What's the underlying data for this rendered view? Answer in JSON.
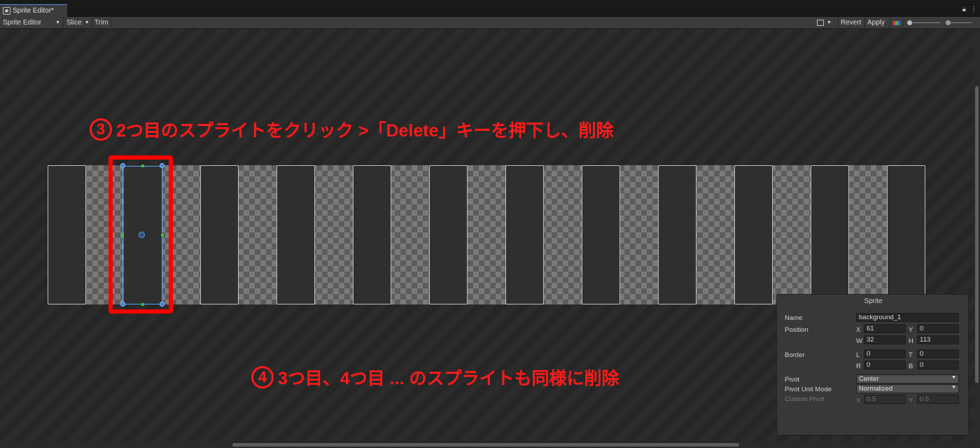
{
  "tab": {
    "title": "Sprite Editor*",
    "lock_icon": "lock-icon",
    "menu_icon": "kebab-menu-icon"
  },
  "toolbar": {
    "mode": "Sprite Editor",
    "slice": "Slice",
    "trim": "Trim",
    "revert": "Revert",
    "apply": "Apply"
  },
  "annotations": {
    "step3_num": "3",
    "step3_text": "2つ目のスプライトをクリック >「Delete」キーを押下し、削除",
    "step4_num": "4",
    "step4_text": "3つ目、4つ目 ... のスプライトも同様に削除",
    "color": "#ff1a1a"
  },
  "sprite_panel": {
    "title": "Sprite",
    "name_label": "Name",
    "name_value": "background_1",
    "position_label": "Position",
    "x_label": "X",
    "x_value": "61",
    "y_label": "Y",
    "y_value": "0",
    "w_label": "W",
    "w_value": "32",
    "h_label": "H",
    "h_value": "113",
    "border_label": "Border",
    "l_label": "L",
    "l_value": "0",
    "t_label": "T",
    "t_value": "0",
    "r_label": "R",
    "r_value": "0",
    "b_label": "B",
    "b_value": "0",
    "pivot_label": "Pivot",
    "pivot_value": "Center",
    "pivot_unit_label": "Pivot Unit Mode",
    "pivot_unit_value": "Normalized",
    "custom_pivot_label": "Custom Pivot",
    "cp_x_label": "X",
    "cp_x_value": "0.5",
    "cp_y_label": "Y",
    "cp_y_value": "0.5"
  },
  "sprite_count": 12,
  "selected_sprite_index": 1
}
